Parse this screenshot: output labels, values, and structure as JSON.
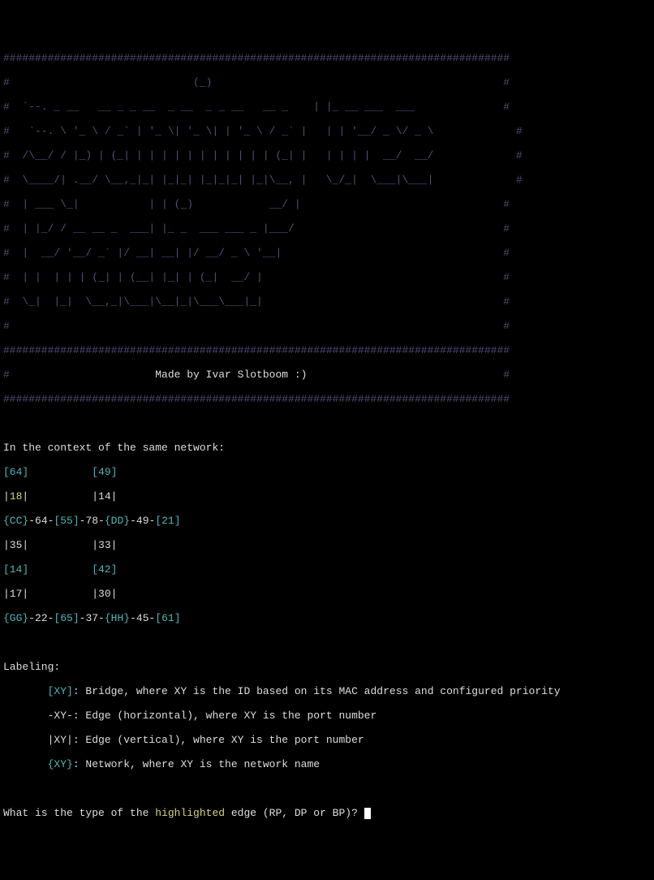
{
  "header": {
    "border_full": "################################################################################",
    "rows": [
      "#                             (_)                                              #",
      "#  `--. _ __   __ _ _ __  _ __  _ _ __   __ _    | |_ __ ___  ___              #",
      "#   `--. \\ '_ \\ / _` | '_ \\| '_ \\| | '_ \\ / _` |   | | '__/ _ \\/ _ \\             #",
      "#  /\\__/ / |_) | (_| | | | | | | | | | | | (_| |   | | | |  __/  __/             #",
      "#  \\____/| .__/ \\__,_|_| |_|_| |_|_|_| |_|\\__, |   \\_/_|  \\___|\\___|             #",
      "#  | ___ \\_|           | | (_)            __/ |                                #",
      "#  | |_/ / __ __ _  ___| |_ _  ___ ___ _ |___/                                 #",
      "#  |  __/ '__/ _` |/ __| __| |/ __/ _ \\ '__|                                   #",
      "#  | |  | | | (_| | (__| |_| | (_|  __/ |                                      #",
      "#  \\_|  |_|  \\__,_|\\___|\\__|_|\\___\\___|_|                                      #",
      "#                                                                              #"
    ],
    "made_by_prefix": "#                       ",
    "made_by": "Made by Ivar Slotboom :)",
    "made_by_suffix": "                               #"
  },
  "context_line": "In the context of the same network:",
  "network": {
    "line1": {
      "a": "[64]",
      "sp": "          ",
      "b": "[49]"
    },
    "line2": {
      "a": "|",
      "b": "18",
      "c": "|          |14|"
    },
    "line3": {
      "a": "{CC}",
      "b": "-64-",
      "c": "[55]",
      "d": "-78-",
      "e": "{DD}",
      "f": "-49-",
      "g": "[21]"
    },
    "line4": "|35|          |33|",
    "line5": {
      "a": "[14]",
      "sp": "          ",
      "b": "[42]"
    },
    "line6": "|17|          |30|",
    "line7": {
      "a": "{GG}",
      "b": "-22-",
      "c": "[65]",
      "d": "-37-",
      "e": "{HH}",
      "f": "-45-",
      "g": "[61]"
    }
  },
  "labeling": {
    "title": "Labeling:",
    "bridge": {
      "pre": "       ",
      "tag": "[XY]",
      "text": ": Bridge, where XY is the ID based on its MAC address and configured priority"
    },
    "edge_h": {
      "pre": "       -XY-: Edge (horizontal), where XY is the port number"
    },
    "edge_v": {
      "pre": "       |XY|: Edge (vertical), where XY is the port number"
    },
    "network": {
      "pre": "       ",
      "tag": "{XY}",
      "text": ": Network, where XY is the network name"
    }
  },
  "prompt": {
    "p1": "What is the type of the ",
    "hl": "highlighted",
    "p2": " edge (RP, DP or BP)? "
  }
}
